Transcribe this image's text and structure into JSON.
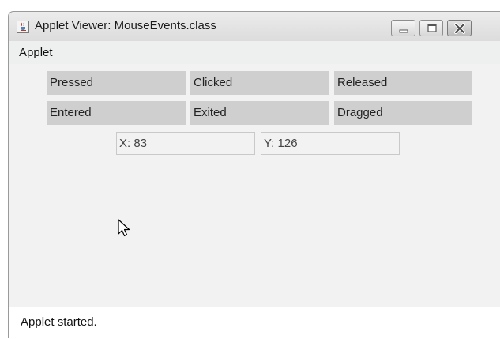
{
  "window": {
    "title": "Applet Viewer: MouseEvents.class",
    "icon": "java-cup-icon",
    "controls": [
      "minimize-icon",
      "maximize-icon",
      "close-icon"
    ]
  },
  "menubar": {
    "items": [
      {
        "label": "Applet"
      }
    ]
  },
  "applet": {
    "labels": {
      "pressed": "Pressed",
      "clicked": "Clicked",
      "released": "Released",
      "entered": "Entered",
      "exited": "Exited",
      "dragged": "Dragged"
    },
    "coords": {
      "x": "X: 83",
      "y": "Y: 126"
    },
    "pointer_icon": "arrow-cursor-icon"
  },
  "status": {
    "text": "Applet started."
  },
  "colors": {
    "label_bg": "#cfcfcf",
    "applet_bg": "#f1f2f1",
    "status_bg": "#ffffff"
  }
}
